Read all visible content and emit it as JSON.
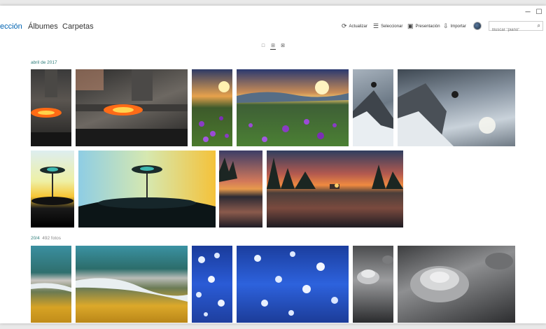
{
  "window": {
    "minimize_glyph": "─",
    "maximize_glyph": "☐"
  },
  "nav": {
    "tabs": [
      {
        "label": "ección",
        "active": true
      },
      {
        "label": "Álbumes",
        "active": false
      },
      {
        "label": "Carpetas",
        "active": false
      }
    ],
    "accent_color": "#0063b1"
  },
  "toolbar": {
    "refresh_label": "Actualizar",
    "refresh_icon": "⟳",
    "select_label": "Seleccionar",
    "select_icon": "☰",
    "slideshow_label": "Presentación",
    "slideshow_icon": "▣",
    "import_label": "Importar",
    "import_icon": "⇩"
  },
  "search": {
    "placeholder": "Buscar \"piano\"",
    "icon": "⌕"
  },
  "view_toggles": [
    "□",
    "⊞",
    "⊠"
  ],
  "groups": [
    {
      "date": "abril de 2017",
      "count": ""
    },
    {
      "date": "20/4",
      "count": "492 fotos"
    }
  ],
  "date_color": "#2e7d7a"
}
